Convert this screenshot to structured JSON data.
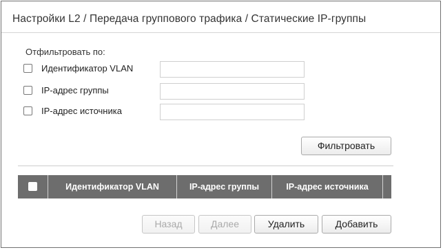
{
  "page": {
    "title": "Настройки L2 / Передача группового трафика / Статические IP-группы"
  },
  "filter": {
    "label": "Отфильтровать по:",
    "fields": [
      {
        "label": "Идентификатор VLAN",
        "checked": false,
        "value": ""
      },
      {
        "label": "IP-адрес группы",
        "checked": false,
        "value": ""
      },
      {
        "label": "IP-адрес источника",
        "checked": false,
        "value": ""
      }
    ],
    "apply_label": "Фильтровать"
  },
  "table": {
    "columns": [
      "Идентификатор VLAN",
      "IP-адрес группы",
      "IP-адрес источника"
    ],
    "rows": []
  },
  "actions": {
    "back_label": "Назад",
    "next_label": "Далее",
    "delete_label": "Удалить",
    "add_label": "Добавить"
  },
  "colors": {
    "table_header_bg": "#6d6d6d",
    "disabled_text": "#aaaaaa"
  }
}
